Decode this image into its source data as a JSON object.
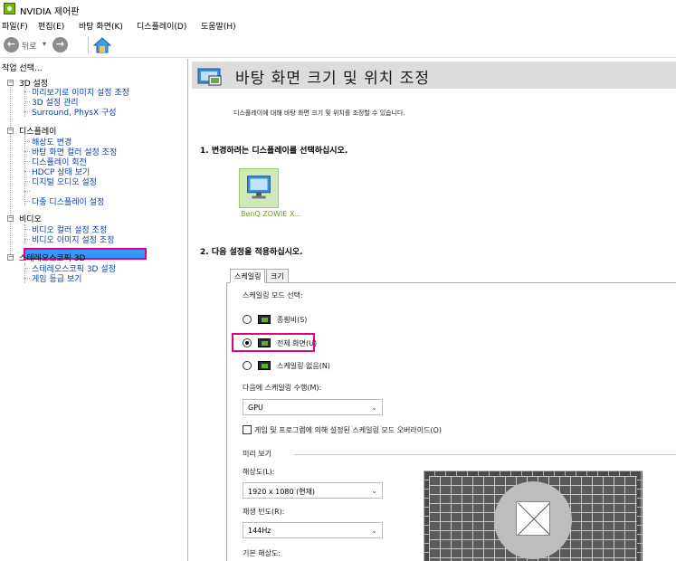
{
  "window": {
    "title": "NVIDIA 제어판"
  },
  "menu": [
    "파일(F)",
    "편집(E)",
    "바탕 화면(K)",
    "디스플레이(D)",
    "도움말(H)"
  ],
  "toolbar": {
    "back_label": "뒤로",
    "dropdown": "▾"
  },
  "tree": {
    "header": "작업 선택...",
    "groups": [
      {
        "label": "3D 설정",
        "items": [
          "미리보기로 이미지 설정 조정",
          "3D 설정 관리",
          "Surround, PhysX 구성"
        ]
      },
      {
        "label": "디스플레이",
        "items": [
          "해상도 변경",
          "바탕 화면 컬러 설정 조정",
          "디스플레이 회전",
          "HDCP 상태 보기",
          "디지털 오디오 설정",
          "바탕 화면 크기 및 위치 조정",
          "다중 디스플레이 설정"
        ]
      },
      {
        "label": "비디오",
        "items": [
          "비디오 컬러 설정 조정",
          "비디오 이미지 설정 조정"
        ]
      },
      {
        "label": "스테레오스코픽 3D",
        "items": [
          "스테레오스코픽 3D 설정",
          "게임 등급 보기"
        ]
      }
    ]
  },
  "page": {
    "title": "바탕 화면 크기 및 위치 조정",
    "description": "디스플레이에 대해 바탕 화면 크기 및 위치를 조정할 수 있습니다.",
    "section1": "1. 변경하려는 디스플레이를 선택하십시오.",
    "display_name": "BenQ ZOWIE X...",
    "section2": "2. 다음 설정을 적용하십시오."
  },
  "tabs": [
    {
      "label": "스케일링",
      "active": true
    },
    {
      "label": "크기",
      "active": false
    }
  ],
  "scaling": {
    "mode_label": "스케일링 모드 선택:",
    "options": [
      {
        "label": "종횡비(S)",
        "selected": false
      },
      {
        "label": "전체 화면(U)",
        "selected": true
      },
      {
        "label": "스케일링 없음(N)",
        "selected": false
      }
    ],
    "perform_on_label": "다음에 스케일링 수행(M):",
    "perform_on_value": "GPU",
    "override_label": "게임 및 프로그램에 의해 설정된 스케일링 모드 오버라이드(O)",
    "override_checked": false
  },
  "preview": {
    "group_label": "미리 보기",
    "resolution_label": "해상도(L):",
    "resolution_value": "1920 x 1080 (현재)",
    "refresh_label": "재생 빈도(R):",
    "refresh_value": "144Hz",
    "native_label": "기본 해상도:"
  }
}
